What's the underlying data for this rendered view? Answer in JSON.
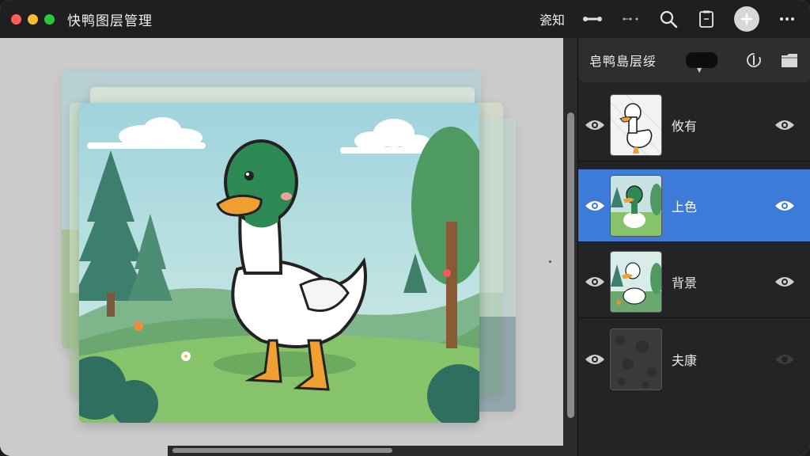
{
  "app": {
    "title": "快鸭图层管理"
  },
  "toolbar": {
    "text_button": "瓷知",
    "icons": [
      "link-icon",
      "dots-link-icon",
      "search-icon",
      "bookmark-icon",
      "add-icon",
      "more-icon"
    ]
  },
  "layers_panel": {
    "title": "皂鸭島层绥",
    "layers": [
      {
        "name": "攸有",
        "selected": false,
        "thumb": "duck-outline"
      },
      {
        "name": "上色",
        "selected": true,
        "thumb": "duck-color"
      },
      {
        "name": "背景",
        "selected": false,
        "thumb": "duck-bg"
      },
      {
        "name": "夫康",
        "selected": false,
        "thumb": "texture"
      }
    ]
  },
  "colors": {
    "accent": "#3d7bd8",
    "titlebar": "#1f1f21",
    "panel": "#242426",
    "canvas_bg": "#cbcbcb"
  }
}
